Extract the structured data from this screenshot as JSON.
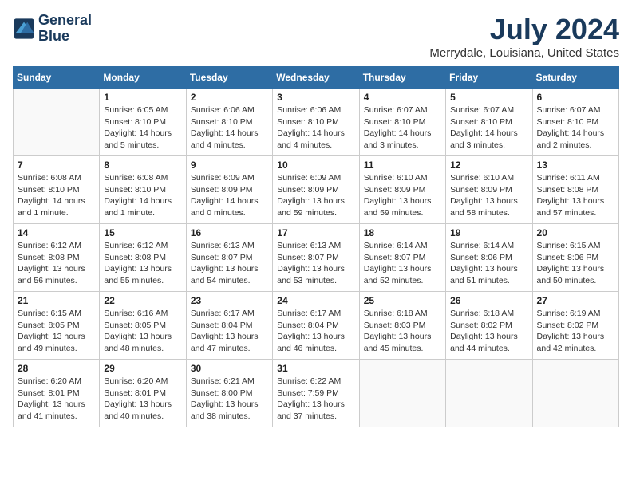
{
  "header": {
    "logo_line1": "General",
    "logo_line2": "Blue",
    "month_year": "July 2024",
    "location": "Merrydale, Louisiana, United States"
  },
  "days_of_week": [
    "Sunday",
    "Monday",
    "Tuesday",
    "Wednesday",
    "Thursday",
    "Friday",
    "Saturday"
  ],
  "weeks": [
    [
      {
        "day": "",
        "info": ""
      },
      {
        "day": "1",
        "info": "Sunrise: 6:05 AM\nSunset: 8:10 PM\nDaylight: 14 hours\nand 5 minutes."
      },
      {
        "day": "2",
        "info": "Sunrise: 6:06 AM\nSunset: 8:10 PM\nDaylight: 14 hours\nand 4 minutes."
      },
      {
        "day": "3",
        "info": "Sunrise: 6:06 AM\nSunset: 8:10 PM\nDaylight: 14 hours\nand 4 minutes."
      },
      {
        "day": "4",
        "info": "Sunrise: 6:07 AM\nSunset: 8:10 PM\nDaylight: 14 hours\nand 3 minutes."
      },
      {
        "day": "5",
        "info": "Sunrise: 6:07 AM\nSunset: 8:10 PM\nDaylight: 14 hours\nand 3 minutes."
      },
      {
        "day": "6",
        "info": "Sunrise: 6:07 AM\nSunset: 8:10 PM\nDaylight: 14 hours\nand 2 minutes."
      }
    ],
    [
      {
        "day": "7",
        "info": "Sunrise: 6:08 AM\nSunset: 8:10 PM\nDaylight: 14 hours\nand 1 minute."
      },
      {
        "day": "8",
        "info": "Sunrise: 6:08 AM\nSunset: 8:10 PM\nDaylight: 14 hours\nand 1 minute."
      },
      {
        "day": "9",
        "info": "Sunrise: 6:09 AM\nSunset: 8:09 PM\nDaylight: 14 hours\nand 0 minutes."
      },
      {
        "day": "10",
        "info": "Sunrise: 6:09 AM\nSunset: 8:09 PM\nDaylight: 13 hours\nand 59 minutes."
      },
      {
        "day": "11",
        "info": "Sunrise: 6:10 AM\nSunset: 8:09 PM\nDaylight: 13 hours\nand 59 minutes."
      },
      {
        "day": "12",
        "info": "Sunrise: 6:10 AM\nSunset: 8:09 PM\nDaylight: 13 hours\nand 58 minutes."
      },
      {
        "day": "13",
        "info": "Sunrise: 6:11 AM\nSunset: 8:08 PM\nDaylight: 13 hours\nand 57 minutes."
      }
    ],
    [
      {
        "day": "14",
        "info": "Sunrise: 6:12 AM\nSunset: 8:08 PM\nDaylight: 13 hours\nand 56 minutes."
      },
      {
        "day": "15",
        "info": "Sunrise: 6:12 AM\nSunset: 8:08 PM\nDaylight: 13 hours\nand 55 minutes."
      },
      {
        "day": "16",
        "info": "Sunrise: 6:13 AM\nSunset: 8:07 PM\nDaylight: 13 hours\nand 54 minutes."
      },
      {
        "day": "17",
        "info": "Sunrise: 6:13 AM\nSunset: 8:07 PM\nDaylight: 13 hours\nand 53 minutes."
      },
      {
        "day": "18",
        "info": "Sunrise: 6:14 AM\nSunset: 8:07 PM\nDaylight: 13 hours\nand 52 minutes."
      },
      {
        "day": "19",
        "info": "Sunrise: 6:14 AM\nSunset: 8:06 PM\nDaylight: 13 hours\nand 51 minutes."
      },
      {
        "day": "20",
        "info": "Sunrise: 6:15 AM\nSunset: 8:06 PM\nDaylight: 13 hours\nand 50 minutes."
      }
    ],
    [
      {
        "day": "21",
        "info": "Sunrise: 6:15 AM\nSunset: 8:05 PM\nDaylight: 13 hours\nand 49 minutes."
      },
      {
        "day": "22",
        "info": "Sunrise: 6:16 AM\nSunset: 8:05 PM\nDaylight: 13 hours\nand 48 minutes."
      },
      {
        "day": "23",
        "info": "Sunrise: 6:17 AM\nSunset: 8:04 PM\nDaylight: 13 hours\nand 47 minutes."
      },
      {
        "day": "24",
        "info": "Sunrise: 6:17 AM\nSunset: 8:04 PM\nDaylight: 13 hours\nand 46 minutes."
      },
      {
        "day": "25",
        "info": "Sunrise: 6:18 AM\nSunset: 8:03 PM\nDaylight: 13 hours\nand 45 minutes."
      },
      {
        "day": "26",
        "info": "Sunrise: 6:18 AM\nSunset: 8:02 PM\nDaylight: 13 hours\nand 44 minutes."
      },
      {
        "day": "27",
        "info": "Sunrise: 6:19 AM\nSunset: 8:02 PM\nDaylight: 13 hours\nand 42 minutes."
      }
    ],
    [
      {
        "day": "28",
        "info": "Sunrise: 6:20 AM\nSunset: 8:01 PM\nDaylight: 13 hours\nand 41 minutes."
      },
      {
        "day": "29",
        "info": "Sunrise: 6:20 AM\nSunset: 8:01 PM\nDaylight: 13 hours\nand 40 minutes."
      },
      {
        "day": "30",
        "info": "Sunrise: 6:21 AM\nSunset: 8:00 PM\nDaylight: 13 hours\nand 38 minutes."
      },
      {
        "day": "31",
        "info": "Sunrise: 6:22 AM\nSunset: 7:59 PM\nDaylight: 13 hours\nand 37 minutes."
      },
      {
        "day": "",
        "info": ""
      },
      {
        "day": "",
        "info": ""
      },
      {
        "day": "",
        "info": ""
      }
    ]
  ]
}
